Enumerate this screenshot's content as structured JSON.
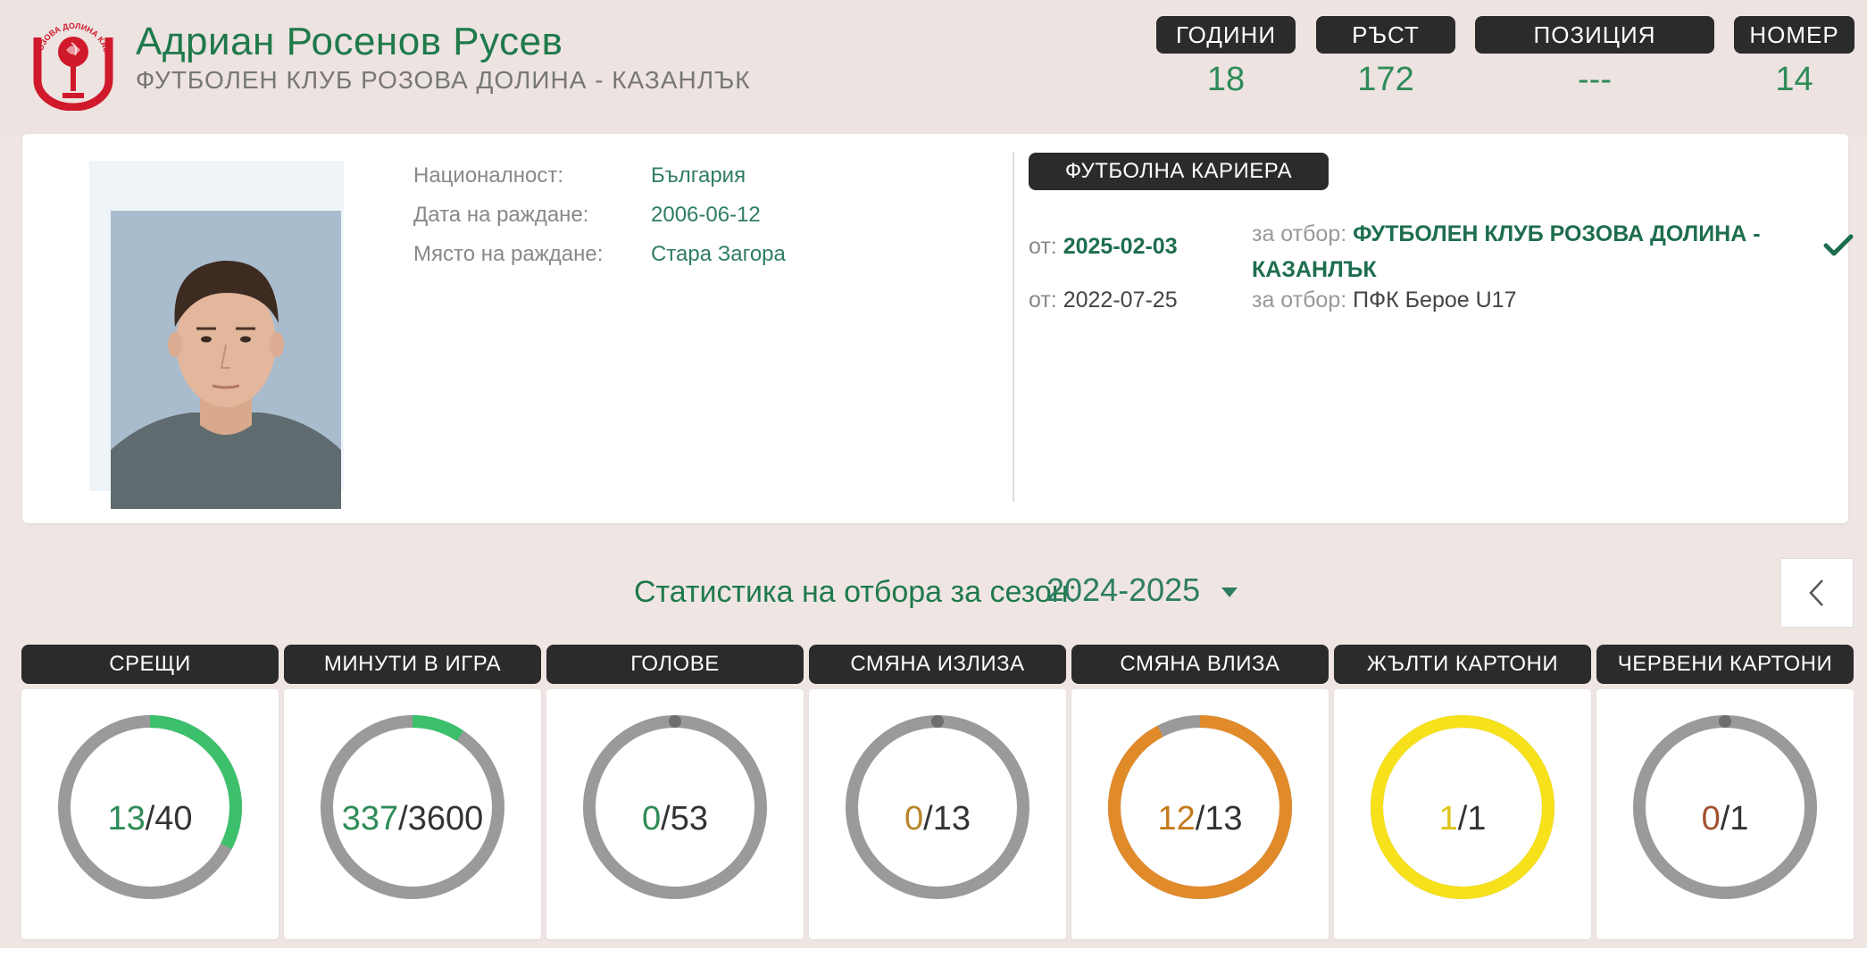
{
  "player": {
    "name": "Адриан Росенов Русев",
    "club": "ФУТБОЛЕН КЛУБ РОЗОВА ДОЛИНА - КАЗАНЛЪК"
  },
  "logo": {
    "icon": "rose-club-logo",
    "text": "РОЗОВА ДОЛИНА КАЗАНЛЪК",
    "color": "#d0192a"
  },
  "header_stats": [
    {
      "label": "ГОДИНИ",
      "value": "18"
    },
    {
      "label": "РЪСТ",
      "value": "172"
    },
    {
      "label": "ПОЗИЦИЯ",
      "value": "---"
    },
    {
      "label": "НОМЕР",
      "value": "14"
    }
  ],
  "details": [
    {
      "key": "Националност:",
      "value": "България"
    },
    {
      "key": "Дата на раждане:",
      "value": "2006-06-12"
    },
    {
      "key": "Място на раждане:",
      "value": "Стара Загора"
    }
  ],
  "career": {
    "heading": "ФУТБОЛНА КАРИЕРА",
    "from_label": "от:",
    "team_label": "за отбор:",
    "entries": [
      {
        "date": "2025-02-03",
        "team_line1": "ФУТБОЛЕН КЛУБ РОЗОВА ДОЛИНА -",
        "team_line2": "КАЗАНЛЪК",
        "current": true
      },
      {
        "date": "2022-07-25",
        "team_line1": "ПФК Берое U17",
        "team_line2": "",
        "current": false
      }
    ]
  },
  "season": {
    "title": "Статистика на отбора за сезон:",
    "selected": "2024-2025"
  },
  "stats": [
    {
      "label": "СРЕЩИ",
      "num": "13",
      "den": "40",
      "ratio": 0.325,
      "color": "#3cc06b",
      "num_color": "#2e8b57"
    },
    {
      "label": "МИНУТИ В ИГРА",
      "num": "337",
      "den": "3600",
      "ratio": 0.0936,
      "color": "#3cc06b",
      "num_color": "#2e8b57"
    },
    {
      "label": "ГОЛОВЕ",
      "num": "0",
      "den": "53",
      "ratio": 0,
      "color": "#3cc06b",
      "num_color": "#2e8b57"
    },
    {
      "label": "СМЯНА ИЗЛИЗА",
      "num": "0",
      "den": "13",
      "ratio": 0,
      "color": "#e08a2a",
      "num_color": "#b8862c"
    },
    {
      "label": "СМЯНА ВЛИЗА",
      "num": "12",
      "den": "13",
      "ratio": 0.923,
      "color": "#e08a2a",
      "num_color": "#c47a1c"
    },
    {
      "label": "ЖЪЛТИ КАРТОНИ",
      "num": "1",
      "den": "1",
      "ratio": 1,
      "color": "#f6e11a",
      "num_color": "#e0c41a"
    },
    {
      "label": "ЧЕРВЕНИ КАРТОНИ",
      "num": "0",
      "den": "1",
      "ratio": 0,
      "color": "#d0192a",
      "num_color": "#a0522d"
    }
  ],
  "colors": {
    "accent_green": "#1f7a4a",
    "ring_track": "#9a9a9a",
    "label_bg": "#2b2b2b"
  }
}
